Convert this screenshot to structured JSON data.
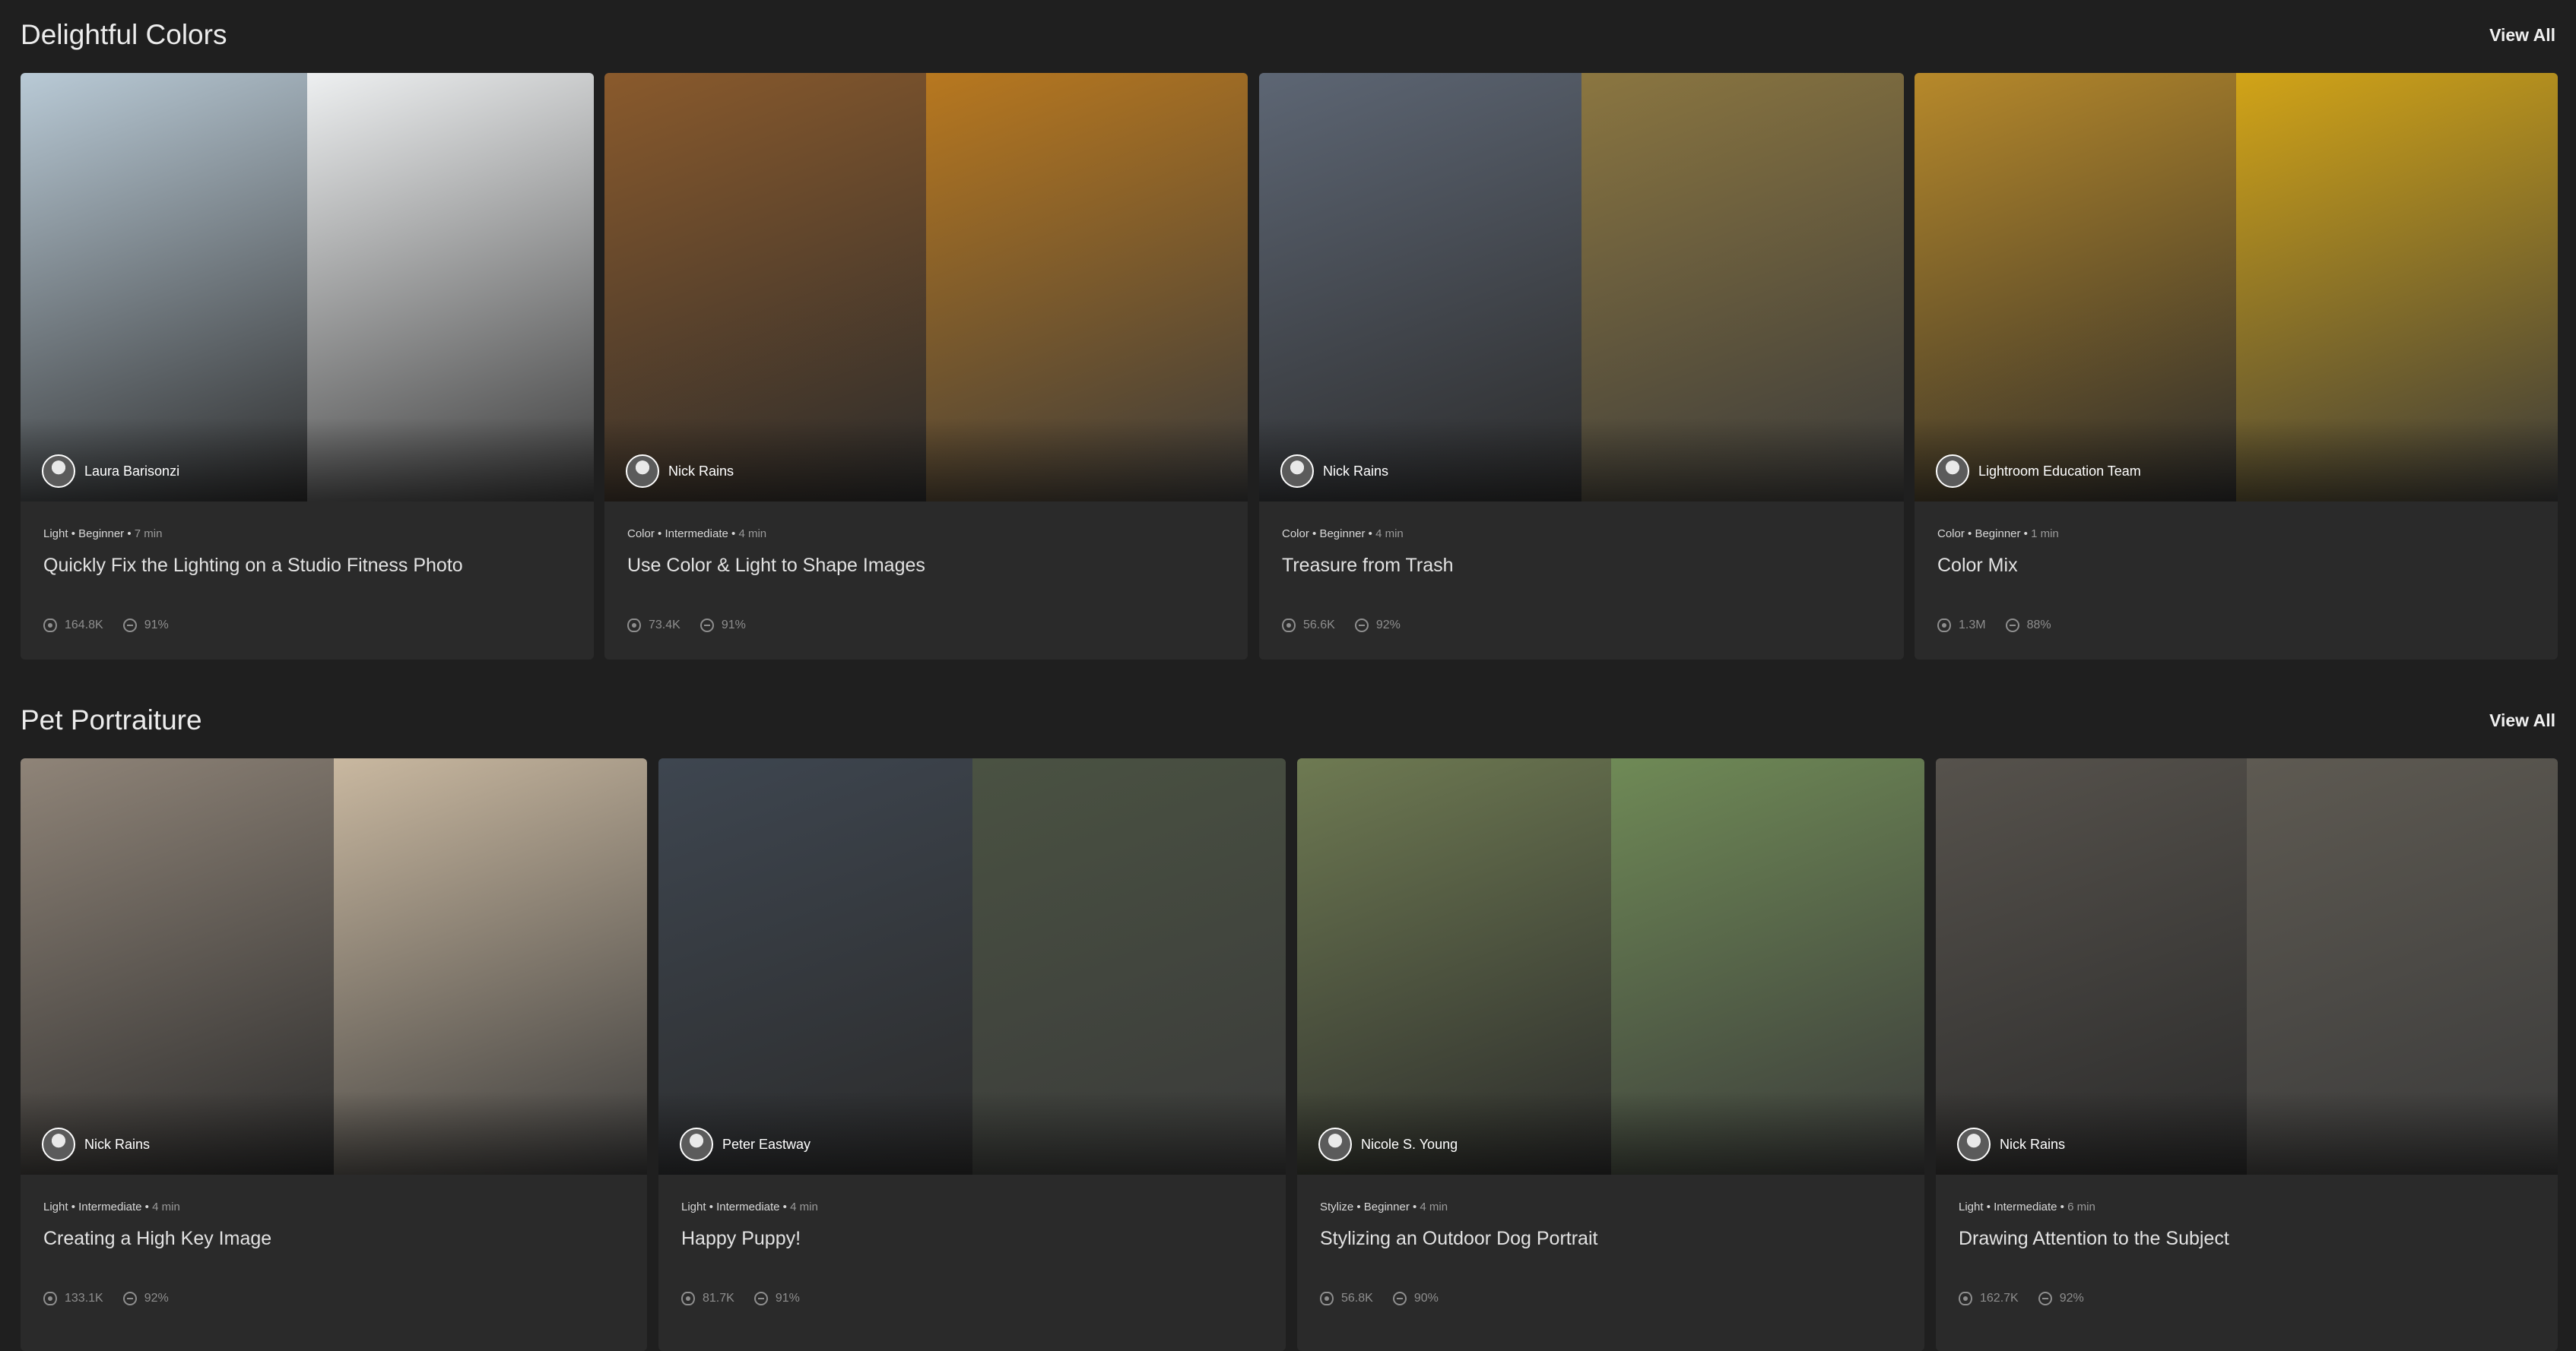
{
  "sections": [
    {
      "title": "Delightful Colors",
      "view_all": "View All",
      "cards": [
        {
          "author": "Laura Barisonzi",
          "category": "Light",
          "level": "Beginner",
          "duration": "7 min",
          "title": "Quickly Fix the Lighting on a Studio Fitness Photo",
          "views": "164.8K",
          "rating": "91%",
          "colors": [
            "#b9cad6",
            "#eef0f1"
          ]
        },
        {
          "author": "Nick Rains",
          "category": "Color",
          "level": "Intermediate",
          "duration": "4 min",
          "title": "Use Color & Light to Shape Images",
          "views": "73.4K",
          "rating": "91%",
          "colors": [
            "#8a5a2c",
            "#b8781f"
          ]
        },
        {
          "author": "Nick Rains",
          "category": "Color",
          "level": "Beginner",
          "duration": "4 min",
          "title": "Treasure from Trash",
          "views": "56.6K",
          "rating": "92%",
          "colors": [
            "#5d6674",
            "#8b7640"
          ]
        },
        {
          "author": "Lightroom Education Team",
          "category": "Color",
          "level": "Beginner",
          "duration": "1 min",
          "title": "Color Mix",
          "views": "1.3M",
          "rating": "88%",
          "colors": [
            "#b7892a",
            "#d2a417"
          ]
        }
      ]
    },
    {
      "title": "Pet Portraiture",
      "view_all": "View All",
      "cards": [
        {
          "author": "Nick Rains",
          "category": "Light",
          "level": "Intermediate",
          "duration": "4 min",
          "title": "Creating a High Key Image",
          "views": "133.1K",
          "rating": "92%",
          "colors": [
            "#8f8478",
            "#c9b8a0"
          ]
        },
        {
          "author": "Peter Eastway",
          "category": "Light",
          "level": "Intermediate",
          "duration": "4 min",
          "title": "Happy Puppy!",
          "views": "81.7K",
          "rating": "91%",
          "colors": [
            "#3e4650",
            "#4a5242"
          ]
        },
        {
          "author": "Nicole S. Young",
          "category": "Stylize",
          "level": "Beginner",
          "duration": "4 min",
          "title": "Stylizing an Outdoor Dog Portrait",
          "views": "56.8K",
          "rating": "90%",
          "colors": [
            "#6e7a52",
            "#6f8a56"
          ]
        },
        {
          "author": "Nick Rains",
          "category": "Light",
          "level": "Intermediate",
          "duration": "6 min",
          "title": "Drawing Attention to the Subject",
          "views": "162.7K",
          "rating": "92%",
          "colors": [
            "#56524c",
            "#5e5a52"
          ]
        }
      ]
    }
  ]
}
